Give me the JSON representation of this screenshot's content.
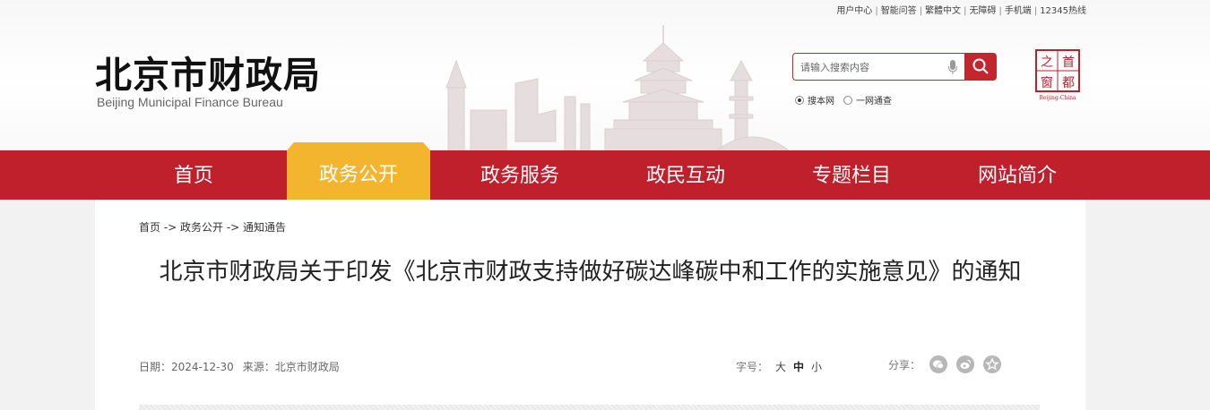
{
  "top_links": [
    "用户中心",
    "智能问答",
    "繁體中文",
    "无障碍",
    "手机端",
    "12345热线"
  ],
  "logo": {
    "cn": "北京市财政局",
    "en": "Beijing Municipal Finance Bureau"
  },
  "search": {
    "placeholder": "请输入搜索内容",
    "scope_options": [
      "搜本网",
      "一网通查"
    ]
  },
  "capital_logo": {
    "chars": [
      "之",
      "首",
      "窗",
      "都"
    ],
    "en": "Beijing-China"
  },
  "nav": {
    "items": [
      "首页",
      "政务公开",
      "政务服务",
      "政民互动",
      "专题栏目",
      "网站简介"
    ],
    "active_index": 1
  },
  "breadcrumb": "首页 -> 政务公开 -> 通知通告",
  "article": {
    "title": "北京市财政局关于印发《北京市财政支持做好碳达峰碳中和工作的实施意见》的通知",
    "date": "日期：2024-12-30",
    "source": "来源：北京市财政局"
  },
  "font_size": {
    "label": "字号：",
    "options": [
      "大",
      "中",
      "小"
    ]
  },
  "share": {
    "label": "分享：",
    "icons": [
      "wechat-icon",
      "weibo-icon",
      "favorite-icon"
    ]
  },
  "colors": {
    "brand_red": "#c0202b",
    "active_gold": "#f2b52d"
  }
}
